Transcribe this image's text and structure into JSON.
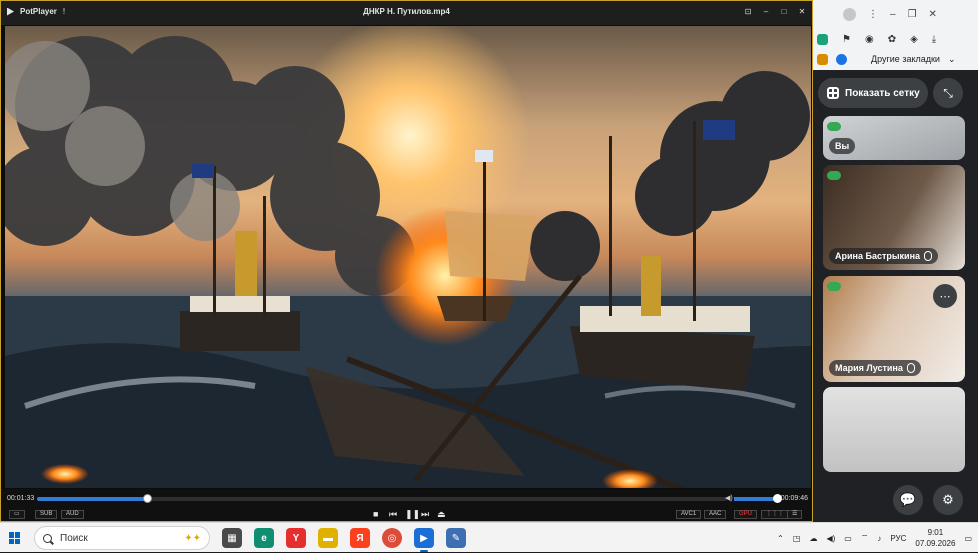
{
  "player": {
    "app_name": "PotPlayer",
    "app_flags": "!",
    "title": "ДНКР Н. Путилов.mp4",
    "window_buttons": [
      "⊡",
      "‒",
      "□",
      "✕"
    ],
    "time_current": "00:01:33",
    "time_total": "00:09:46",
    "progress_fraction": 0.159,
    "volume_fraction": 1.0,
    "left_buttons": [
      "▭",
      "SUB",
      "AUD"
    ],
    "playback_buttons": [
      "■",
      "⏮",
      "❚❚",
      "⏭",
      "⏏"
    ],
    "right_buttons": [
      "AVC1",
      "AAC",
      "GPU",
      "⋮⋮⋮",
      "☰"
    ],
    "colors": {
      "accent": "#2f7fd9",
      "frame": "#c9a227",
      "gpu": "#ff4040"
    }
  },
  "meet": {
    "bookmarks_label": "Другие закладки",
    "grid_button_label": "Показать сетку",
    "tiles": [
      {
        "name": "Вы"
      },
      {
        "name": "Арина Бастрыкина"
      },
      {
        "name": "Мария Лустина"
      },
      {
        "name": ""
      }
    ]
  },
  "taskbar": {
    "search_placeholder": "Поиск",
    "language": "РУС",
    "time": "9:01",
    "date": "07.09.2026"
  }
}
